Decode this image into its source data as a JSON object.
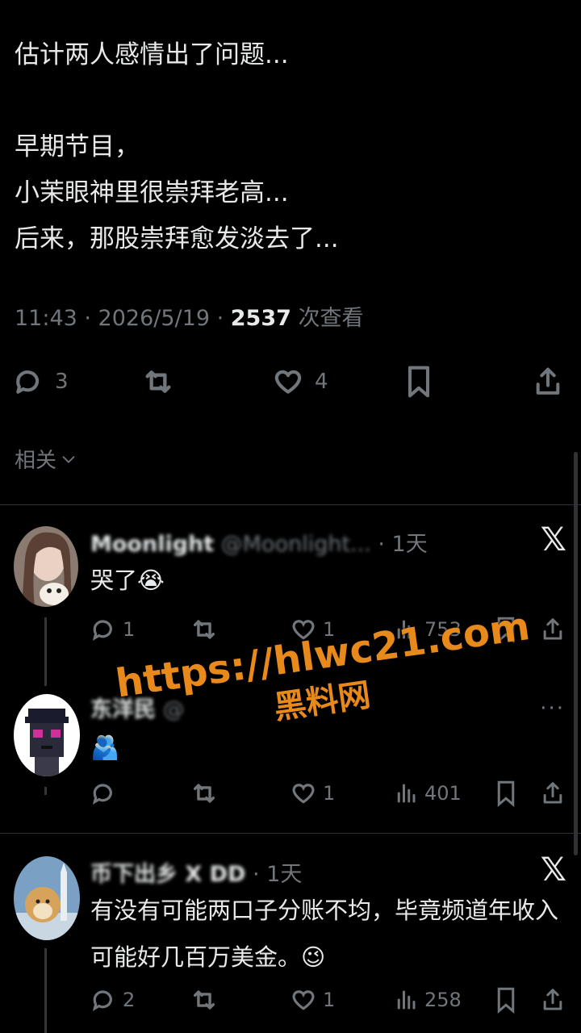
{
  "post": {
    "lines": [
      "估计两人感情出了问题...",
      "",
      "早期节目，",
      "小茉眼神里很崇拜老高...",
      "后来，那股崇拜愈发淡去了..."
    ],
    "time": "11:43 · 2026/5/19 · ",
    "views_count": "2537",
    "views_label": " 次查看",
    "actions": {
      "replies": "3",
      "likes": "4"
    }
  },
  "related_label": "相关",
  "replies": [
    {
      "name": "Moonlight",
      "handle": "@Moonlight...",
      "time": "· 1天",
      "text": "哭了😭",
      "avatar": "woman-with-pet",
      "actions": {
        "replies": "1",
        "retweets": "",
        "likes": "1",
        "views": "753"
      }
    },
    {
      "name": "东洋民",
      "handle": "@",
      "time": "",
      "text": "🫂",
      "avatar": "pixel-punk",
      "actions": {
        "replies": "",
        "retweets": "",
        "likes": "1",
        "views": "401"
      }
    },
    {
      "name": "币下出乡 X DD",
      "handle": "",
      "time": "· 1天",
      "text": "有没有可能两口子分账不均，毕竟频道年收入可能好几百万美金。😉",
      "avatar": "doge-rocket",
      "actions": {
        "replies": "2",
        "retweets": "",
        "likes": "1",
        "views": "258"
      }
    }
  ],
  "x_logo": "𝕏",
  "more_menu": "···",
  "watermark": {
    "url": "https://hlwc21.com",
    "site": "黑料网"
  },
  "colors": {
    "background": "#000000",
    "text": "#e7e9ea",
    "muted": "#71767b",
    "watermark": "#e8891c"
  }
}
